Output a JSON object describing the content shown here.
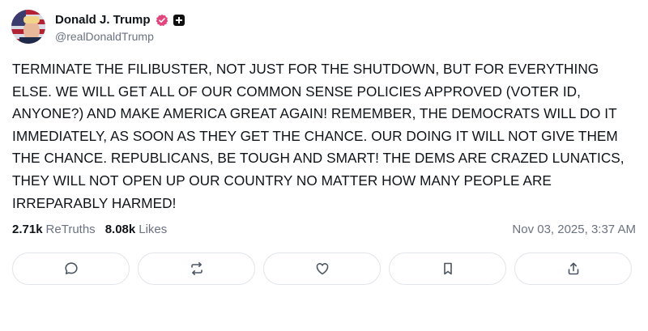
{
  "author": {
    "display_name": "Donald J. Trump",
    "handle": "@realDonaldTrump",
    "verified_icon": "verified-badge-icon",
    "plus_icon": "plus-badge-icon"
  },
  "post": {
    "text": "TERMINATE THE FILIBUSTER, NOT JUST FOR THE SHUTDOWN, BUT FOR EVERYTHING ELSE. WE WILL GET ALL OF OUR COMMON SENSE POLICIES APPROVED (VOTER ID, ANYONE?) AND MAKE AMERICA GREAT AGAIN! REMEMBER, THE DEMOCRATS WILL DO IT IMMEDIATELY, AS SOON AS THEY GET THE CHANCE. OUR DOING IT WILL NOT GIVE THEM THE CHANCE. REPUBLICANS, BE TOUGH AND SMART! THE DEMS ARE CRAZED LUNATICS, THEY WILL NOT OPEN UP OUR COUNTRY NO MATTER HOW MANY PEOPLE ARE IRREPARABLY HARMED!",
    "retruths_count": "2.71k",
    "retruths_label": "ReTruths",
    "likes_count": "8.08k",
    "likes_label": "Likes",
    "timestamp": "Nov 03, 2025, 3:37 AM"
  },
  "actions": [
    {
      "name": "reply-button",
      "icon": "comment-icon"
    },
    {
      "name": "retruth-button",
      "icon": "repost-icon"
    },
    {
      "name": "like-button",
      "icon": "heart-icon"
    },
    {
      "name": "bookmark-button",
      "icon": "bookmark-icon"
    },
    {
      "name": "share-button",
      "icon": "share-icon"
    }
  ],
  "colors": {
    "text": "#0f1419",
    "muted": "#6b7280",
    "border": "#e1e4e8",
    "verified": "#e0457b"
  }
}
